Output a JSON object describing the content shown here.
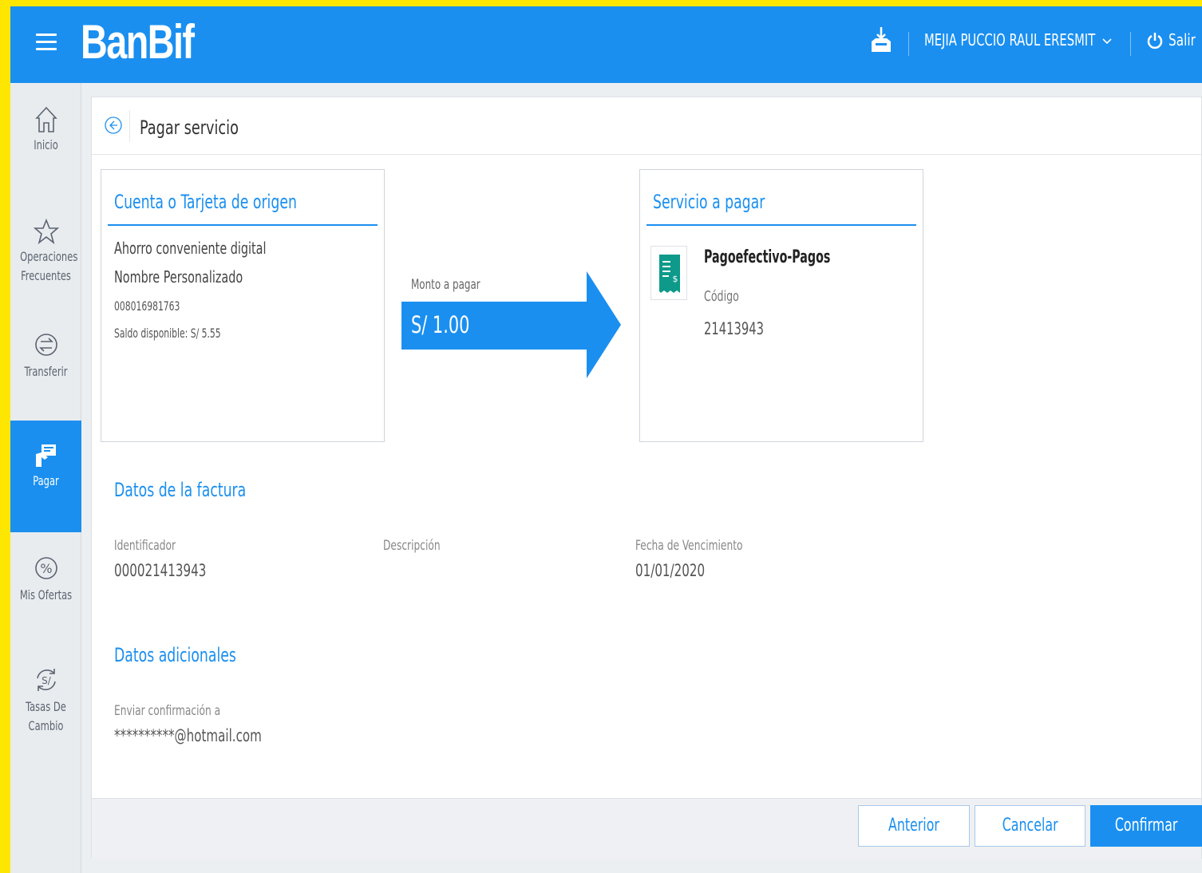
{
  "brand": {
    "logo": "BanBif",
    "accent": "#1a8ff0",
    "frame": "#ffe600"
  },
  "header": {
    "user_name": "MEJIA PUCCIO RAUL ERESMIT",
    "logout_label": "Salir"
  },
  "sidebar": {
    "items": [
      {
        "label": "Inicio",
        "icon": "home-icon"
      },
      {
        "label": "Operaciones Frecuentes",
        "icon": "star-icon"
      },
      {
        "label": "Transferir",
        "icon": "transfer-icon"
      },
      {
        "label": "Pagar",
        "icon": "pay-icon",
        "active": true
      },
      {
        "label": "Mis Ofertas",
        "icon": "percent-icon"
      },
      {
        "label": "Tasas De Cambio",
        "icon": "exchange-icon"
      }
    ]
  },
  "page": {
    "title": "Pagar servicio"
  },
  "origin": {
    "heading": "Cuenta o Tarjeta de origen",
    "account_type": "Ahorro conveniente digital",
    "custom_name": "Nombre Personalizado",
    "account_number": "008016981763",
    "balance": "Saldo disponible: S/  5.55"
  },
  "amount": {
    "label": "Monto a pagar",
    "value": "S/  1.00"
  },
  "service": {
    "heading": "Servicio a pagar",
    "name": "Pagoefectivo-Pagos",
    "code_label": "Código",
    "code_value": "21413943"
  },
  "invoice": {
    "heading": "Datos de la factura",
    "identifier_label": "Identificador",
    "identifier_value": "000021413943",
    "description_label": "Descripción",
    "due_label": "Fecha de Vencimiento",
    "due_value": "01/01/2020"
  },
  "additional": {
    "heading": "Datos adicionales",
    "confirm_label": "Enviar confirmación a",
    "confirm_value": "**********@hotmail.com"
  },
  "footer": {
    "previous_label": "Anterior",
    "cancel_label": "Cancelar",
    "confirm_label": "Confirmar"
  }
}
